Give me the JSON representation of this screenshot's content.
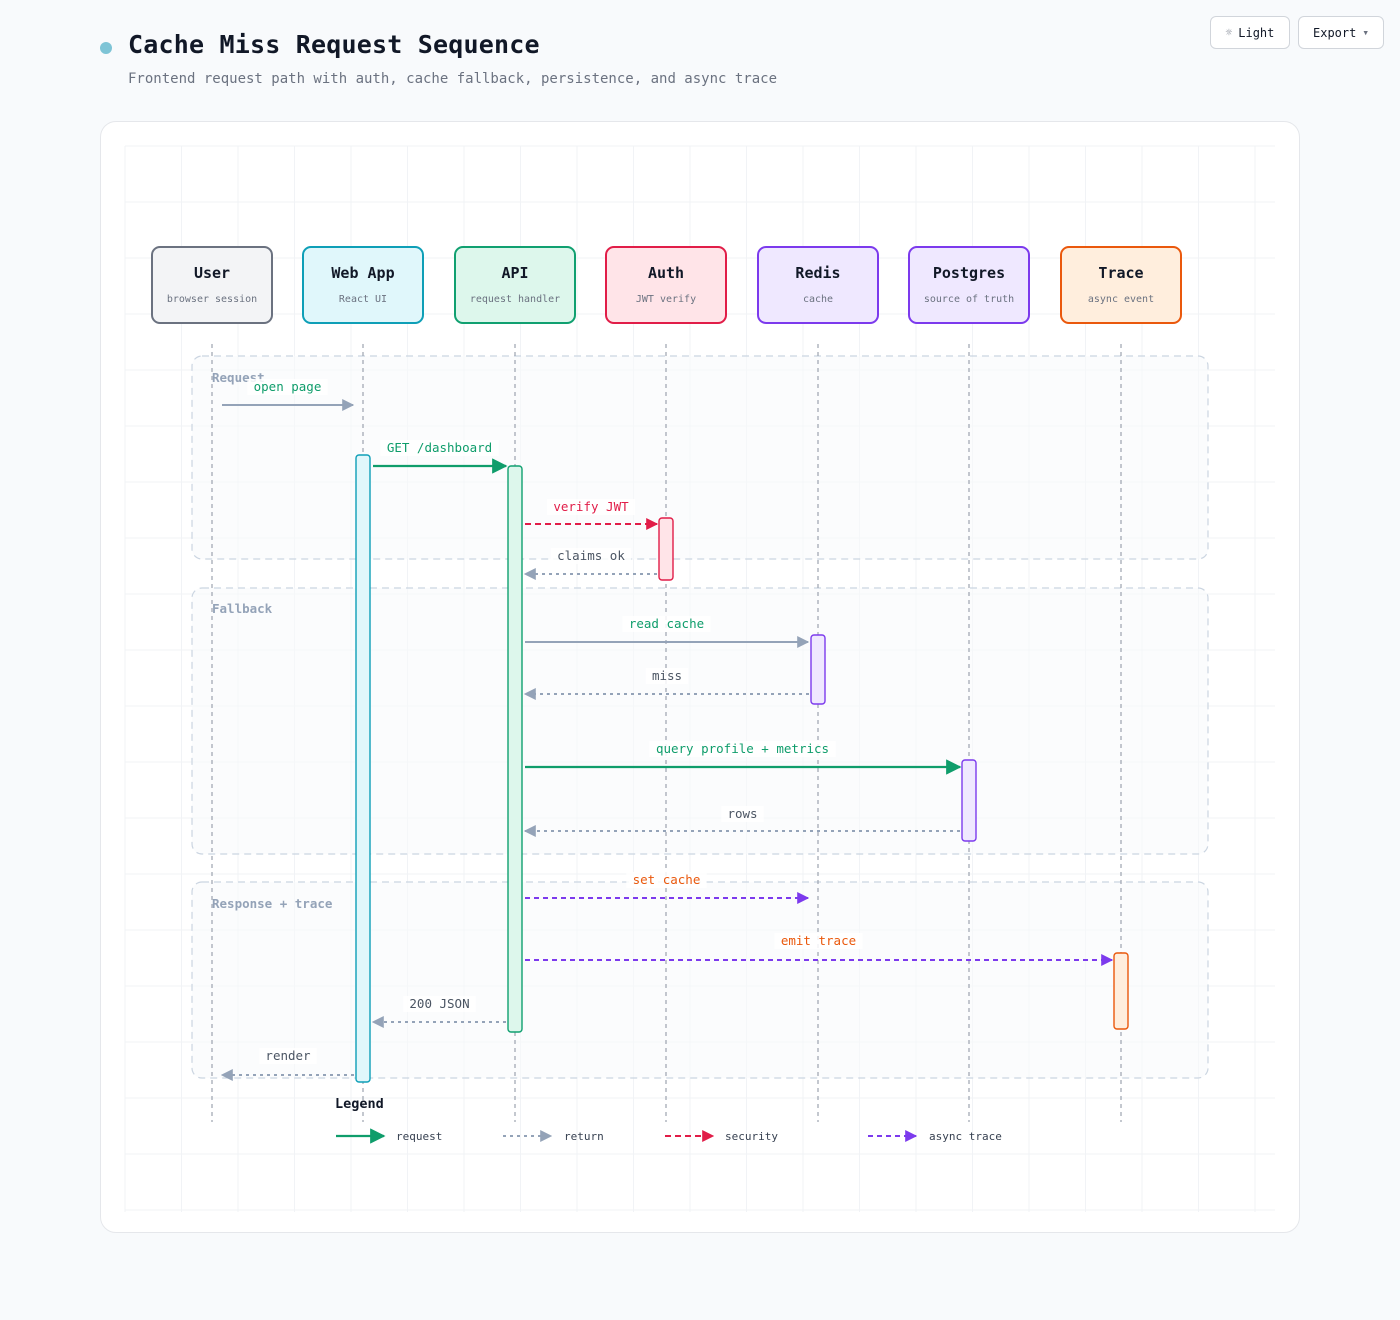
{
  "header": {
    "title": "Cache Miss Request Sequence",
    "subtitle": "Frontend request path with auth, cache fallback, persistence, and async trace"
  },
  "toolbar": {
    "theme_icon": "sun-icon",
    "theme_glyph": "☼",
    "theme_label": "Light",
    "export_label": "Export",
    "export_icon": "chevron-down-icon",
    "export_glyph": "▾"
  },
  "participants": [
    {
      "id": "user",
      "name": "User",
      "sub": "browser session",
      "stroke": "#6b7280",
      "fill": "#f3f4f6"
    },
    {
      "id": "web",
      "name": "Web App",
      "sub": "React UI",
      "stroke": "#0e9fb7",
      "fill": "#e0f7fb"
    },
    {
      "id": "api",
      "name": "API",
      "sub": "request handler",
      "stroke": "#10a070",
      "fill": "#ddf7ec"
    },
    {
      "id": "auth",
      "name": "Auth",
      "sub": "JWT verify",
      "stroke": "#e11d48",
      "fill": "#ffe4e8"
    },
    {
      "id": "redis",
      "name": "Redis",
      "sub": "cache",
      "stroke": "#7c3aed",
      "fill": "#efe8ff"
    },
    {
      "id": "pg",
      "name": "Postgres",
      "sub": "source of truth",
      "stroke": "#7c3aed",
      "fill": "#efe8ff"
    },
    {
      "id": "trace",
      "name": "Trace",
      "sub": "async event",
      "stroke": "#ea580c",
      "fill": "#ffeedd"
    }
  ],
  "groups": [
    {
      "label": "Request"
    },
    {
      "label": "Fallback"
    },
    {
      "label": "Response + trace"
    }
  ],
  "messages": [
    {
      "from": "user",
      "to": "web",
      "label": "open page",
      "kind": "request-plain"
    },
    {
      "from": "web",
      "to": "api",
      "label": "GET /dashboard",
      "kind": "request"
    },
    {
      "from": "api",
      "to": "auth",
      "label": "verify JWT",
      "kind": "security"
    },
    {
      "from": "auth",
      "to": "api",
      "label": "claims ok",
      "kind": "return"
    },
    {
      "from": "api",
      "to": "redis",
      "label": "read cache",
      "kind": "request-plain"
    },
    {
      "from": "redis",
      "to": "api",
      "label": "miss",
      "kind": "return"
    },
    {
      "from": "api",
      "to": "pg",
      "label": "query profile + metrics",
      "kind": "request"
    },
    {
      "from": "pg",
      "to": "api",
      "label": "rows",
      "kind": "return"
    },
    {
      "from": "api",
      "to": "redis",
      "label": "set cache",
      "kind": "async"
    },
    {
      "from": "api",
      "to": "trace",
      "label": "emit trace",
      "kind": "async"
    },
    {
      "from": "api",
      "to": "web",
      "label": "200 JSON",
      "kind": "return"
    },
    {
      "from": "web",
      "to": "user",
      "label": "render",
      "kind": "return"
    }
  ],
  "legend": {
    "title": "Legend",
    "items": [
      {
        "kind": "request",
        "label": "request"
      },
      {
        "kind": "return",
        "label": "return"
      },
      {
        "kind": "security",
        "label": "security"
      },
      {
        "kind": "async",
        "label": "async trace"
      }
    ]
  },
  "colors": {
    "request": "#0f9d6b",
    "request_label": "#0f9d6b",
    "return": "#94a3b8",
    "return_label": "#4b5563",
    "security": "#e11d48",
    "async": "#7c3aed",
    "async_label": "#ea580c",
    "group_label": "#94a3b8"
  }
}
